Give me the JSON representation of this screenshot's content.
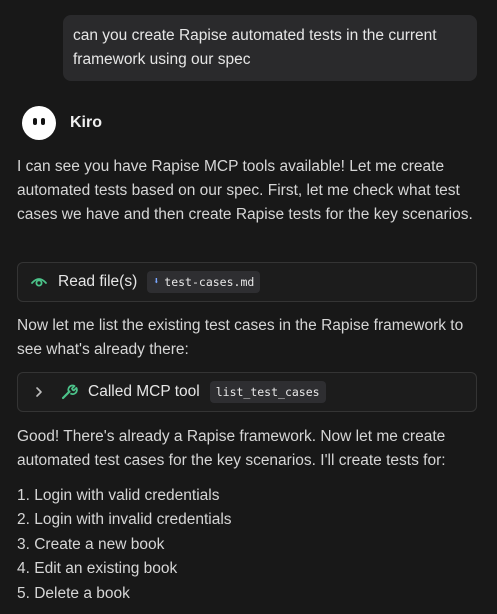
{
  "user_message": "can you create Rapise automated tests in the current framework using our spec",
  "agent": {
    "name": "Kiro"
  },
  "messages": {
    "intro": "I can see you have Rapise MCP tools available! Let me create automated tests based on our spec. First, let me check what test cases we have and then create Rapise tests for the key scenarios.",
    "list_intro": "Now let me list the existing test cases in the Rapise framework to see what's already there:",
    "good": "Good! There's already a Rapise framework. Now let me create automated test cases for the key scenarios. I'll create tests for:"
  },
  "tool_calls": [
    {
      "label": "Read file(s)",
      "chip": "test-cases.md",
      "icon": "eye-icon",
      "chip_icon": "download-arrow-icon"
    },
    {
      "label": "Called MCP tool",
      "chip": "list_test_cases",
      "icon": "wrench-icon",
      "expand_icon": "chevron-right-icon"
    }
  ],
  "steps": [
    "1. Login with valid credentials",
    "2. Login with invalid credentials",
    "3. Create a new book",
    "4. Edit an existing book",
    "5. Delete a book"
  ],
  "colors": {
    "background": "#181818",
    "bubble": "#2a2a2c",
    "icon_green": "#4cc38a",
    "chip_bg": "#2e2e31"
  }
}
